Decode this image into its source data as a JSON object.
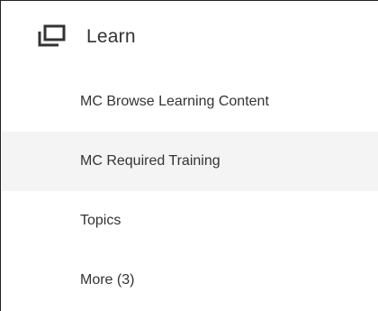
{
  "section": {
    "icon": "window-stack-icon",
    "title": "Learn"
  },
  "menu": {
    "items": [
      {
        "label": "MC Browse Learning Content",
        "highlighted": false
      },
      {
        "label": "MC Required Training",
        "highlighted": true
      },
      {
        "label": "Topics",
        "highlighted": false
      },
      {
        "label": "More (3)",
        "highlighted": false
      }
    ]
  },
  "colors": {
    "text": "#333333",
    "border": "#222222",
    "highlight": "#f4f4f4",
    "background": "#ffffff"
  }
}
